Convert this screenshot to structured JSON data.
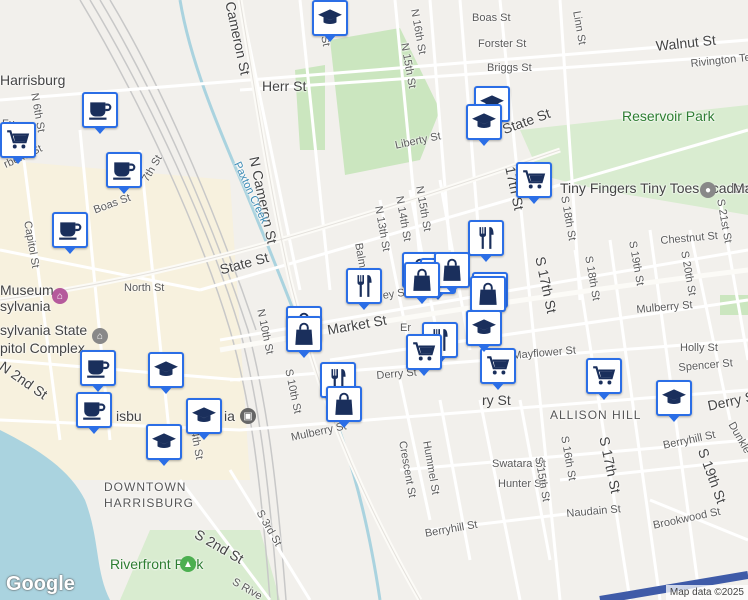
{
  "map": {
    "colors": {
      "land": "#f2f0ec",
      "road": "#ffffff",
      "major_road": "#fdfcf8",
      "rail": "#c8c8c8",
      "water": "#aad3df",
      "park": "#cbe6bf",
      "marker_border": "#2b6ee6"
    },
    "labels": {
      "boas_st_top": "Boas St",
      "forster_st": "Forster St",
      "n16th_top": "N 16th St",
      "linn_st": "Linn St",
      "walnut_st": "Walnut St",
      "rivington": "Rivington Te",
      "n15th_top": "N 15th St",
      "briggs_st": "Briggs St",
      "herr_st": "Herr St",
      "harrisburg": "Harrisburg",
      "n6th_st": "N 6th St",
      "reservoir_park": "Reservoir Park",
      "liberty_st": "Liberty St",
      "state_st_top": "State St",
      "n_cameron_st": "N Cameron St",
      "cameron_st_top": "Cameron St",
      "n14th_top": "N 14th St",
      "paxton_creek": "Paxton Creek",
      "n7th_st": "7th St",
      "boas_st_left": "Boas St",
      "tiny_fingers": "Tiny Fingers Tiny Toes Academy",
      "ma": "Ma",
      "s21st_st": "S 21st St",
      "capitol_st": "Capitol St",
      "n15th_st": "N 15th St",
      "n14th_st": "N 14th St",
      "n13th_st": "N 13th St",
      "balm": "Balm",
      "n17th_mid": "17th St",
      "s18th_st": "S 18th St",
      "chestnut_st": "Chestnut St",
      "s19th_st": "S 19th St",
      "s20th_st": "S 20th St",
      "state_st_mid": "State St",
      "north_st": "North St",
      "museum": "Museum",
      "sylvania": "sylvania",
      "s17th_st": "S 17th St",
      "s18th_st2": "S 18th St",
      "mulberry_right": "Mulberry St",
      "ey_st": "ey St",
      "market_st": "Market St",
      "n10th_st": "N 10th St",
      "pa_state_capitol": "sylvania State",
      "capitol_complex": "pitol Complex",
      "er": "Er",
      "holly_st": "Holly St",
      "mayflower_st": "Mayflower St",
      "n2nd_st": "N 2nd St",
      "spencer_st": "Spencer St",
      "derry_st": "Derry St",
      "s10th_st": "S 10th St",
      "allison_hill": "ALLISON HILL",
      "derry_st_right": "Derry St",
      "ry_st": "ry St",
      "isbu": "isbu",
      "ia": "ia",
      "th_st_14": "4th St",
      "mulberry_st": "Mulberry St",
      "hummel_st": "Hummel St",
      "crescent_st": "Crescent St",
      "berryhill_right": "Berryhill St",
      "dunkle": "Dunkle",
      "s19th_bottom": "S 19th St",
      "swatara_st": "Swatara St",
      "s16th_st": "S 16th St",
      "hunter_st": "Hunter St",
      "s15th_st": "S 15th St",
      "s17th_bottom": "S 17th St",
      "downtown": "DOWNTOWN",
      "harrisburg_dt": "HARRISBURG",
      "naudain_st": "Naudain St",
      "brookwood_st": "Brookwood St",
      "s3rd_st": "S 3rd St",
      "berryhill_st": "Berryhill St",
      "s2nd_st": "S 2nd St",
      "riverfront_park": "Riverfront Park",
      "s_river": "S Rive",
      "fu": "Fu",
      "rbeke": "rbeke St"
    },
    "markers": [
      {
        "icon": "coffee-icon"
      },
      {
        "icon": "coffee-icon"
      },
      {
        "icon": "coffee-icon"
      },
      {
        "icon": "coffee-icon"
      },
      {
        "icon": "coffee-icon"
      },
      {
        "icon": "cart-icon"
      },
      {
        "icon": "graduation-cap-icon"
      },
      {
        "icon": "graduation-cap-icon"
      },
      {
        "icon": "graduation-cap-icon"
      },
      {
        "icon": "cart-icon"
      },
      {
        "icon": "restaurant-icon"
      },
      {
        "icon": "restaurant-icon"
      },
      {
        "icon": "shopping-bag-icon"
      },
      {
        "icon": "shopping-bag-icon"
      },
      {
        "icon": "shopping-bag-icon"
      },
      {
        "icon": "shopping-bag-icon"
      },
      {
        "icon": "cart-icon"
      },
      {
        "icon": "restaurant-icon"
      },
      {
        "icon": "cart-icon"
      },
      {
        "icon": "cart-icon"
      },
      {
        "icon": "shopping-bag-icon"
      },
      {
        "icon": "graduation-cap-icon"
      },
      {
        "icon": "shopping-bag-icon"
      },
      {
        "icon": "shopping-bag-icon"
      },
      {
        "icon": "restaurant-icon"
      },
      {
        "icon": "shopping-bag-icon"
      },
      {
        "icon": "graduation-cap-icon"
      },
      {
        "icon": "graduation-cap-icon"
      },
      {
        "icon": "cart-icon"
      },
      {
        "icon": "graduation-cap-icon"
      },
      {
        "icon": "graduation-cap-icon"
      }
    ],
    "logo": "Google",
    "attribution": "Map data ©2025"
  }
}
